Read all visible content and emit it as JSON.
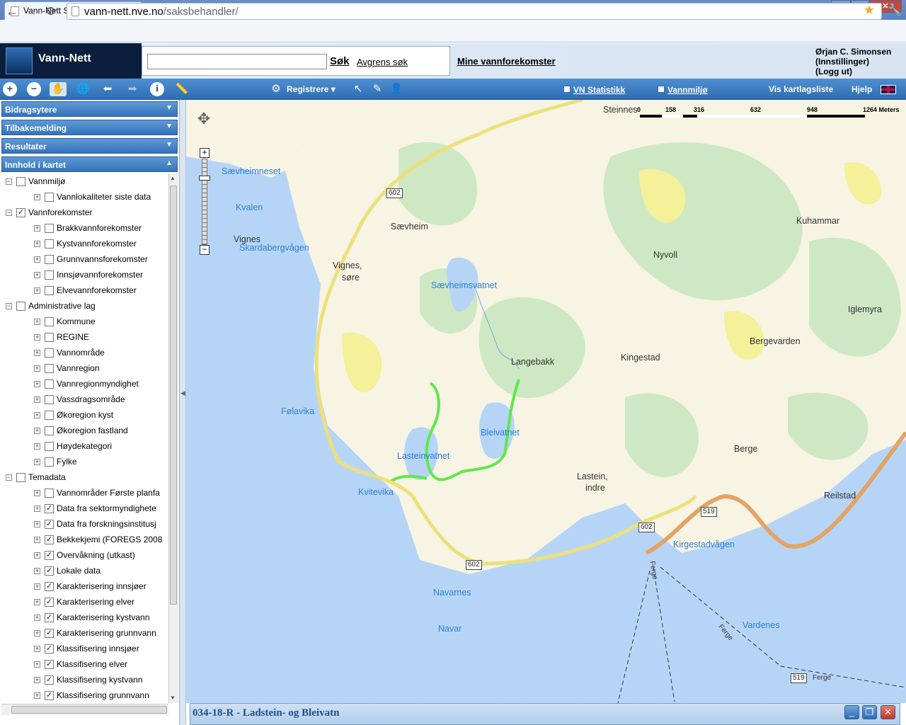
{
  "browser": {
    "tab_title": "Vann-Nett Saksbehandler",
    "tab_close": "×",
    "url_host": "vann-nett.nve.no",
    "url_path": "/saksbehandler/",
    "win_min": "–",
    "win_max": "▭",
    "win_close": "✕"
  },
  "header": {
    "logo_text": "Vann-Nett",
    "search_placeholder": "",
    "search_button": "Søk",
    "refine_link": "Avgrens søk",
    "mine_link": "Mine vannforekomster",
    "user_name": "Ørjan C. Simonsen",
    "user_settings": "(Innstillinger)",
    "user_logout": "(Logg ut)"
  },
  "toolbar": {
    "registrere": "Registrere",
    "vn_statistikk": "VN Statistikk",
    "vannmiljo": "Vannmiljø",
    "vis_kartlagsliste": "Vis kartlagsliste",
    "hjelp": "Hjelp"
  },
  "sidebar": {
    "panels": [
      "Bidragsytere",
      "Tilbakemelding",
      "Resultater",
      "Innhold i kartet"
    ],
    "tree": [
      {
        "label": "Vannmiljø",
        "level": 0,
        "checked": false
      },
      {
        "label": "Vannlokaliteter siste data",
        "level": 1,
        "checked": false
      },
      {
        "label": "Vannforekomster",
        "level": 0,
        "checked": true
      },
      {
        "label": "Brakkvannforekomster",
        "level": 1,
        "checked": false
      },
      {
        "label": "Kystvannforekomster",
        "level": 1,
        "checked": false
      },
      {
        "label": "Grunnvannsforekomster",
        "level": 1,
        "checked": false
      },
      {
        "label": "Innsjøvannforekomster",
        "level": 1,
        "checked": false
      },
      {
        "label": "Elvevannforekomster",
        "level": 1,
        "checked": false
      },
      {
        "label": "Administrative lag",
        "level": 0,
        "checked": false
      },
      {
        "label": "Kommune",
        "level": 1,
        "checked": false
      },
      {
        "label": "REGINE",
        "level": 1,
        "checked": false
      },
      {
        "label": "Vannområde",
        "level": 1,
        "checked": false
      },
      {
        "label": "Vannregion",
        "level": 1,
        "checked": false
      },
      {
        "label": "Vannregionmyndighet",
        "level": 1,
        "checked": false
      },
      {
        "label": "Vassdragsområde",
        "level": 1,
        "checked": false
      },
      {
        "label": "Økoregion kyst",
        "level": 1,
        "checked": false
      },
      {
        "label": "Økoregion fastland",
        "level": 1,
        "checked": false
      },
      {
        "label": "Høydekategori",
        "level": 1,
        "checked": false
      },
      {
        "label": "Fylke",
        "level": 1,
        "checked": false
      },
      {
        "label": "Temadata",
        "level": 0,
        "checked": false
      },
      {
        "label": "Vannområder Første planfa",
        "level": 1,
        "checked": false
      },
      {
        "label": "Data fra sektormyndighete",
        "level": 1,
        "checked": true
      },
      {
        "label": "Data fra forskningsinstitusj",
        "level": 1,
        "checked": true
      },
      {
        "label": "Bekkekjemi (FOREGS 2008",
        "level": 1,
        "checked": true
      },
      {
        "label": "Overvåkning (utkast)",
        "level": 1,
        "checked": true
      },
      {
        "label": "Lokale data",
        "level": 1,
        "checked": true
      },
      {
        "label": "Karakterisering innsjøer",
        "level": 1,
        "checked": true
      },
      {
        "label": "Karakterisering elver",
        "level": 1,
        "checked": true
      },
      {
        "label": "Karakterisering kystvann",
        "level": 1,
        "checked": true
      },
      {
        "label": "Karakterisering grunnvann",
        "level": 1,
        "checked": true
      },
      {
        "label": "Klassifisering innsjøer",
        "level": 1,
        "checked": true
      },
      {
        "label": "Klassifisering elver",
        "level": 1,
        "checked": true
      },
      {
        "label": "Klassifisering kystvann",
        "level": 1,
        "checked": true
      },
      {
        "label": "Klassifisering grunnvann",
        "level": 1,
        "checked": true
      }
    ]
  },
  "map": {
    "scale_labels": [
      "0",
      "158",
      "316",
      "632",
      "948",
      "1264 Meters"
    ],
    "places": [
      {
        "name": "Steinnes",
        "type": "land"
      },
      {
        "name": "Sævheimneset",
        "type": "water"
      },
      {
        "name": "Kvalen",
        "type": "water"
      },
      {
        "name": "Vignes",
        "type": "land"
      },
      {
        "name": "Skardabergvågen",
        "type": "water"
      },
      {
        "name": "Sævheim",
        "type": "land"
      },
      {
        "name": "Vignes,",
        "type": "land"
      },
      {
        "name": "søre",
        "type": "land"
      },
      {
        "name": "Sævheimsvatnet",
        "type": "water"
      },
      {
        "name": "Kuhammar",
        "type": "land"
      },
      {
        "name": "Nyvoll",
        "type": "land"
      },
      {
        "name": "Iglemyra",
        "type": "land"
      },
      {
        "name": "Bergevarden",
        "type": "land"
      },
      {
        "name": "Kingestad",
        "type": "land"
      },
      {
        "name": "Langebakk",
        "type": "land"
      },
      {
        "name": "Følavika",
        "type": "water"
      },
      {
        "name": "Bleivatnet",
        "type": "water"
      },
      {
        "name": "Lasteinvatnet",
        "type": "water"
      },
      {
        "name": "Berge",
        "type": "land"
      },
      {
        "name": "Lastein,",
        "type": "land"
      },
      {
        "name": "indre",
        "type": "land"
      },
      {
        "name": "Reilstad",
        "type": "land"
      },
      {
        "name": "Kvitevika",
        "type": "water"
      },
      {
        "name": "Kirgestadvågen",
        "type": "water"
      },
      {
        "name": "Navarnes",
        "type": "water"
      },
      {
        "name": "Navar",
        "type": "water"
      },
      {
        "name": "Vardenes",
        "type": "water"
      },
      {
        "name": "Ferge",
        "type": "land"
      },
      {
        "name": "Ferge",
        "type": "land"
      },
      {
        "name": "Ferge",
        "type": "land"
      }
    ],
    "roads": [
      "602",
      "602",
      "602",
      "519",
      "519"
    ]
  },
  "info_panel": {
    "title": "034-18-R - Ladstein- og Bleivatn"
  }
}
